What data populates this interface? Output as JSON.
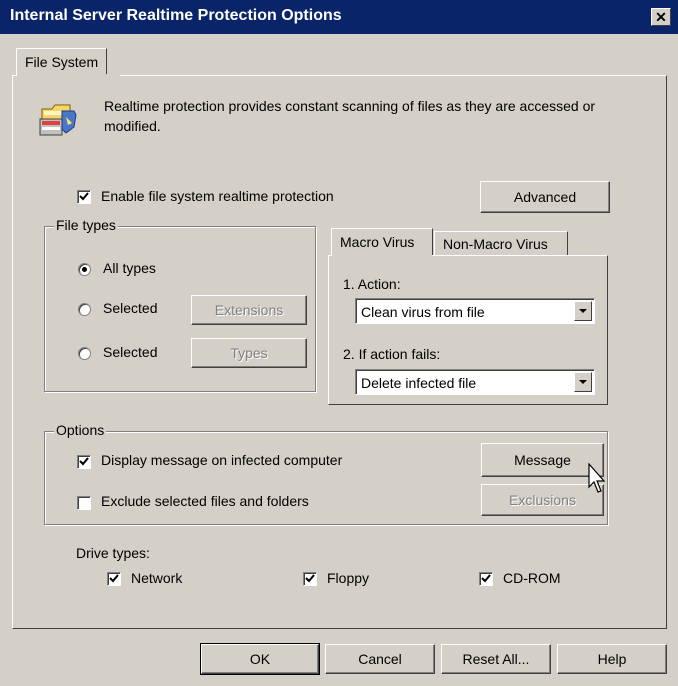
{
  "window": {
    "title": "Internal Server Realtime Protection Options",
    "close_glyph": "✕"
  },
  "tabs": {
    "main": [
      "File System"
    ],
    "virus": [
      "Macro Virus",
      "Non-Macro Virus"
    ]
  },
  "info_text": "Realtime protection provides constant scanning of files as they are accessed or modified.",
  "enable": {
    "label": "Enable file system realtime protection",
    "checked": true
  },
  "advanced_label": "Advanced",
  "file_types": {
    "legend": "File types",
    "all_label": "All types",
    "selected1_label": "Selected",
    "selected2_label": "Selected",
    "extensions_label": "Extensions",
    "types_label": "Types"
  },
  "actions": {
    "action_label": "1. Action:",
    "action_value": "Clean virus from file",
    "fail_label": "2. If action fails:",
    "fail_value": "Delete infected file"
  },
  "options": {
    "legend": "Options",
    "display_label": "Display message on infected computer",
    "display_checked": true,
    "exclude_label": "Exclude selected files and folders",
    "exclude_checked": false,
    "message_label": "Message",
    "exclusions_label": "Exclusions"
  },
  "drive_types": {
    "label": "Drive types:",
    "network": "Network",
    "floppy": "Floppy",
    "cdrom": "CD-ROM"
  },
  "footer": {
    "ok": "OK",
    "cancel": "Cancel",
    "reset": "Reset All...",
    "help": "Help"
  },
  "colors": {
    "titlebar": "#0a246a",
    "face": "#d4d0c8"
  },
  "icons": {
    "info": "folder-shield-icon",
    "cursor": "mouse-pointer-icon"
  }
}
